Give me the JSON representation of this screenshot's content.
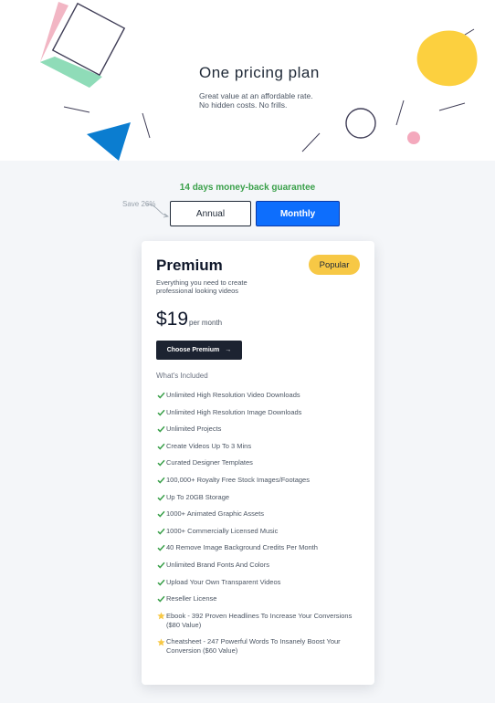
{
  "hero": {
    "title": "One pricing plan",
    "subtitle_line1": "Great value at an affordable rate.",
    "subtitle_line2": "No hidden costs. No frills."
  },
  "billing": {
    "guarantee": "14 days money-back guarantee",
    "save_note": "Save 26%",
    "annual_label": "Annual",
    "monthly_label": "Monthly",
    "selected": "Monthly"
  },
  "plan": {
    "name": "Premium",
    "badge": "Popular",
    "description": "Everything you need to create professional looking videos",
    "price": "$19",
    "period": "per month",
    "cta_label": "Choose Premium",
    "cta_arrow": "→",
    "included_heading": "What's Included",
    "features": [
      {
        "text": "Unlimited High Resolution Video Downloads",
        "icon": "check-icon"
      },
      {
        "text": "Unlimited High Resolution Image Downloads",
        "icon": "check-icon"
      },
      {
        "text": "Unlimited Projects",
        "icon": "check-icon"
      },
      {
        "text": "Create Videos Up To 3 Mins",
        "icon": "check-icon"
      },
      {
        "text": "Curated Designer Templates",
        "icon": "check-icon"
      },
      {
        "text": "100,000+ Royalty Free Stock Images/Footages",
        "icon": "check-icon"
      },
      {
        "text": "Up To 20GB Storage",
        "icon": "check-icon"
      },
      {
        "text": "1000+ Animated Graphic Assets",
        "icon": "check-icon"
      },
      {
        "text": "1000+ Commercially Licensed Music",
        "icon": "check-icon"
      },
      {
        "text": "40 Remove Image Background Credits Per Month",
        "icon": "check-icon"
      },
      {
        "text": "Unlimited Brand Fonts And Colors",
        "icon": "check-icon"
      },
      {
        "text": "Upload Your Own Transparent Videos",
        "icon": "check-icon"
      },
      {
        "text": "Reseller License",
        "icon": "check-icon"
      },
      {
        "text": "Ebook - 392 Proven Headlines To Increase Your Conversions ($80 Value)",
        "icon": "star-icon"
      },
      {
        "text": "Cheatsheet - 247 Powerful Words To Insanely Boost Your Conversion ($60 Value)",
        "icon": "star-icon"
      }
    ]
  },
  "colors": {
    "accent_blue": "#0d6efd",
    "guarantee_green": "#3aa04a",
    "badge_yellow": "#f7c845",
    "check_green": "#3aa04a",
    "star_yellow": "#f7c845",
    "dark_button": "#1c2331"
  }
}
